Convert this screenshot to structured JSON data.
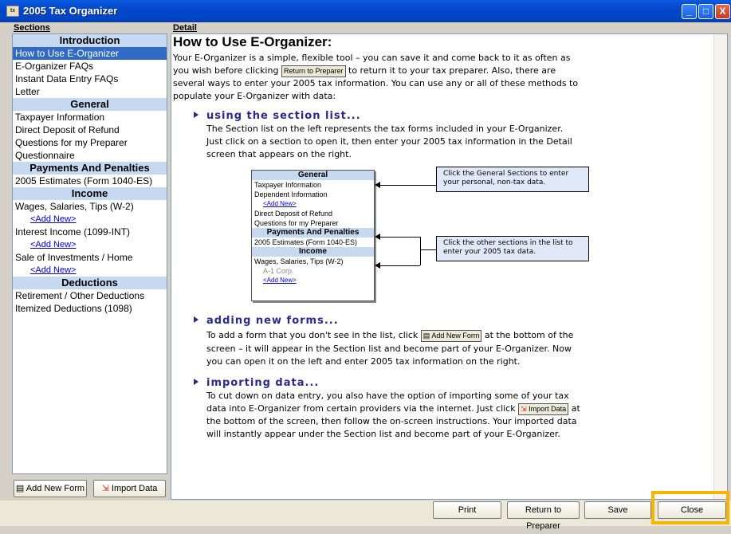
{
  "window": {
    "title": "2005 Tax Organizer",
    "icon_text": "tx",
    "controls": [
      "_",
      "□",
      "X"
    ]
  },
  "sections_header": "Sections",
  "detail_header": "Detail",
  "sidebar": {
    "groups": [
      {
        "heading": "Introduction",
        "items": [
          {
            "label": "How to Use E-Organizer",
            "selected": true
          },
          {
            "label": "E-Organizer FAQs"
          },
          {
            "label": "Instant Data Entry FAQs"
          },
          {
            "label": "Letter"
          }
        ]
      },
      {
        "heading": "General",
        "items": [
          {
            "label": "Taxpayer Information"
          },
          {
            "label": "Direct Deposit of Refund"
          },
          {
            "label": "Questions for my Preparer"
          },
          {
            "label": "Questionnaire"
          }
        ]
      },
      {
        "heading": "Payments And Penalties",
        "items": [
          {
            "label": "2005 Estimates (Form 1040-ES)"
          }
        ]
      },
      {
        "heading": "Income",
        "items": [
          {
            "label": "Wages, Salaries, Tips (W-2)"
          },
          {
            "label": "<Add New>",
            "add": true
          },
          {
            "label": "Interest Income (1099-INT)"
          },
          {
            "label": "<Add New>",
            "add": true
          },
          {
            "label": "Sale of Investments / Home"
          },
          {
            "label": "<Add New>",
            "add": true
          }
        ]
      },
      {
        "heading": "Deductions",
        "items": [
          {
            "label": "Retirement / Other Deductions"
          },
          {
            "label": "Itemized Deductions (1098)"
          }
        ]
      }
    ],
    "add_new_form_label": "Add New Form",
    "import_data_label": "Import Data"
  },
  "detail": {
    "title": "How to Use E-Organizer:",
    "intro_lines": [
      "Your E-Organizer is a simple, flexible tool – you can save it and come back to it as often as",
      "you wish before clicking",
      "to return it to your tax preparer. Also, there are",
      "several ways to enter your 2005 tax information. You can use any or all of these methods to",
      "populate your E-Organizer with data:"
    ],
    "return_btn_inline": "Return to Preparer",
    "section1": {
      "heading": "using the section list...",
      "lines": [
        "The Section list on the left represents the tax forms included in your E-Organizer.",
        "Just click on a section to open it, then enter your 2005 tax information in the Detail",
        "screen that appears on the right."
      ]
    },
    "diagram": {
      "general_heading": "General",
      "general_items": [
        "Taxpayer Information",
        "Dependent Information"
      ],
      "add_new": "<Add New>",
      "general_items2": [
        "Direct Deposit of Refund",
        "Questions for my Preparer"
      ],
      "payments_heading": "Payments And Penalties",
      "payments_items": [
        "2005 Estimates (Form 1040-ES)"
      ],
      "income_heading": "Income",
      "income_items": [
        "Wages, Salaries, Tips (W-2)"
      ],
      "income_sub": "A-1 Corp.",
      "callout1_lines": [
        "Click the General Sections to enter",
        "your personal, non-tax data."
      ],
      "callout2_lines": [
        "Click the other sections in the list to",
        "enter your 2005 tax data."
      ]
    },
    "section2": {
      "heading": "adding new forms...",
      "line1_a": "To add a form that you don't see in the list, click",
      "line1_b": "at the bottom of the",
      "lines": [
        "screen – it will appear in the Section list and become part of your E-Organizer. Now",
        "you can open it on the left and enter 2005 tax information on the right."
      ],
      "btn_inline": "Add New Form"
    },
    "section3": {
      "heading": "importing data...",
      "lines": [
        "To cut down on data entry, you also have the option of importing some of your tax",
        "data into E-Organizer from certain providers via the internet. Just click"
      ],
      "btn_inline": "Import Data",
      "line2_end": "at",
      "lines_after": [
        "the bottom of the screen, then follow the on-screen instructions. Your imported data",
        "will instantly appear under the Section list and become part of your E-Organizer."
      ]
    }
  },
  "footer": {
    "print": "Print",
    "return_to_preparer": "Return to Preparer",
    "save": "Save",
    "close": "Close"
  }
}
